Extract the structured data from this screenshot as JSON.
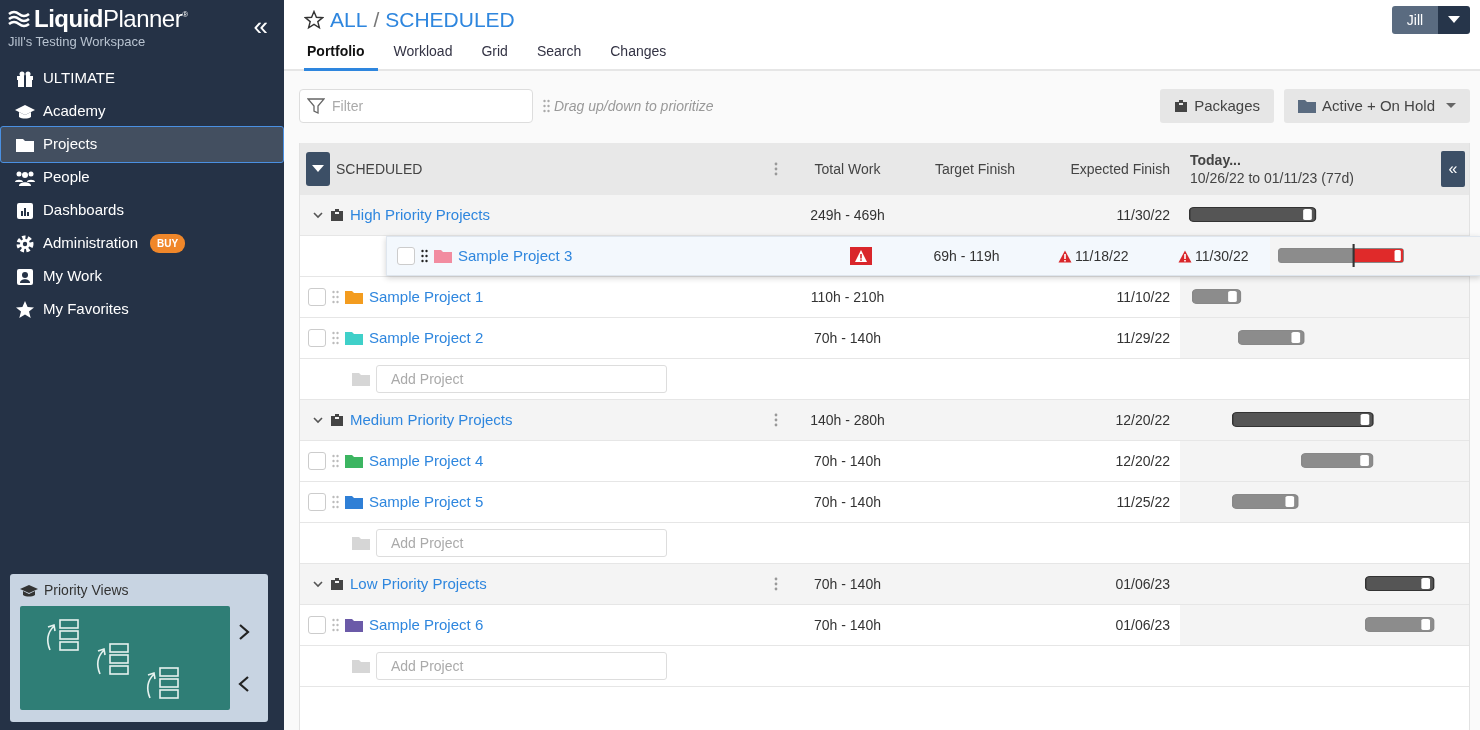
{
  "sidebar": {
    "logo": "**Liquid**Planner$^{®}$",
    "workspace": "Jill's Testing Workspace",
    "collapse_symbol": "«",
    "items": [
      {
        "label": "ULTIMATE",
        "kind": "gift",
        "selected": false
      },
      {
        "label": "Academy",
        "kind": "cap",
        "selected": false
      },
      {
        "label": "Projects",
        "kind": "folder",
        "selected": true
      },
      {
        "label": "People",
        "kind": "people",
        "selected": false
      },
      {
        "label": "Dashboards",
        "kind": "chart",
        "selected": false
      },
      {
        "label": "Administration",
        "kind": "gear",
        "badge": "BUY",
        "selected": false
      },
      {
        "label": "My Work",
        "kind": "person",
        "selected": false
      },
      {
        "label": "My Favorites",
        "kind": "star",
        "selected": false
      }
    ],
    "promo": {
      "title": "Priority Views"
    }
  },
  "header": {
    "breadcrumb": [
      "ALL",
      "SCHEDULED"
    ],
    "separator": "/",
    "tabs": [
      {
        "label": "Portfolio",
        "selected": true
      },
      {
        "label": "Workload",
        "selected": false
      },
      {
        "label": "Grid",
        "selected": false
      },
      {
        "label": "Search",
        "selected": false
      },
      {
        "label": "Changes",
        "selected": false
      }
    ],
    "user": "Jill"
  },
  "toolbar": {
    "filter_placeholder": "Filter",
    "hint": "Drag up/down to prioritize",
    "packages": "Packages",
    "status_filter": "Active + On Hold"
  },
  "table": {
    "title": "SCHEDULED",
    "columns": [
      "Total Work",
      "Target Finish",
      "Expected Finish"
    ],
    "timeline": {
      "title": "Today...",
      "range": "10/26/22 to 01/11/23 (77d)",
      "collapse_symbol": "«"
    },
    "groups": [
      {
        "name": "High Priority Projects",
        "expanded": true,
        "menu_visible": false,
        "total_work": "249h - 469h",
        "expected_finish": "11/30/22",
        "dragging": {
          "name": "Sample Project 3",
          "color": "#f28ca0",
          "checked": false,
          "alert": true,
          "total_work": "69h - 119h",
          "target_finish": "11/18/22",
          "target_warning": true,
          "expected_finish": "11/30/22",
          "expected_warning": true
        },
        "projects": [
          {
            "name": "Sample Project 1",
            "color": "#f39c1f",
            "checked": false,
            "total_work": "110h - 210h",
            "expected_finish": "11/10/22"
          },
          {
            "name": "Sample Project 2",
            "color": "#3fd0c9",
            "checked": false,
            "total_work": "70h - 140h",
            "expected_finish": "11/29/22"
          }
        ],
        "add_placeholder": "Add Project"
      },
      {
        "name": "Medium Priority Projects",
        "expanded": true,
        "menu_visible": true,
        "total_work": "140h - 280h",
        "expected_finish": "12/20/22",
        "projects": [
          {
            "name": "Sample Project 4",
            "color": "#3cb561",
            "checked": false,
            "total_work": "70h - 140h",
            "expected_finish": "12/20/22"
          },
          {
            "name": "Sample Project 5",
            "color": "#2f7fd6",
            "checked": false,
            "total_work": "70h - 140h",
            "expected_finish": "11/25/22"
          }
        ],
        "add_placeholder": "Add Project"
      },
      {
        "name": "Low Priority Projects",
        "expanded": true,
        "menu_visible": true,
        "total_work": "70h - 140h",
        "expected_finish": "01/06/23",
        "projects": [
          {
            "name": "Sample Project 6",
            "color": "#6b5aa8",
            "checked": false,
            "total_work": "70h - 140h",
            "expected_finish": "01/06/23"
          }
        ],
        "add_placeholder": "Add Project"
      }
    ]
  }
}
